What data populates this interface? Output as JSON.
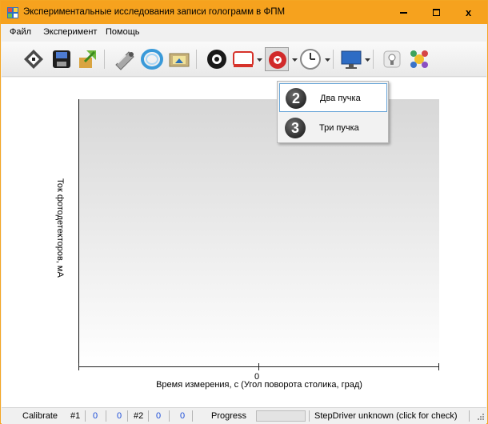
{
  "window": {
    "title": "Экспериментальные исследования записи голограмм в ФПМ",
    "accent_color": "#f6a21e"
  },
  "titlebar_buttons": {
    "minimize": "minimize-icon",
    "maximize": "maximize-icon",
    "close": "close-icon",
    "close_glyph": "x"
  },
  "menu": {
    "items": [
      "Файл",
      "Эксперимент",
      "Помощь"
    ]
  },
  "toolbar": {
    "icons": [
      "floppy-disk-icon",
      "save-disk-icon",
      "export-arrow-icon",
      "laser-device-icon",
      "lens-ring-icon",
      "folder-image-icon",
      "gear-icon",
      "hologram-plate-icon",
      "beam-red-circle-icon",
      "clock-dial-icon",
      "monitor-icon",
      "bulb-icon",
      "molecule-icon"
    ]
  },
  "dropdown": {
    "items": [
      {
        "icon_text": "2",
        "label": "Два пучка",
        "highlighted": true
      },
      {
        "icon_text": "3",
        "label": "Три пучка",
        "highlighted": false
      }
    ]
  },
  "chart_data": {
    "type": "line",
    "series": [],
    "x_tick_labels": [
      "0"
    ],
    "xlabel": "Время измерения, с (Угол поворота столика, град)",
    "ylabel": "Ток фотодетекторов, мА",
    "grid": false
  },
  "status": {
    "calibrate": "Calibrate",
    "ch1_label": "#1",
    "ch1_a": "0",
    "ch1_b": "0",
    "ch2_label": "#2",
    "ch2_a": "0",
    "ch2_b": "0",
    "progress_label": "Progress",
    "progress_value": 0,
    "driver": "StepDriver unknown (click for check)",
    "number_color": "#1d4ed8"
  }
}
